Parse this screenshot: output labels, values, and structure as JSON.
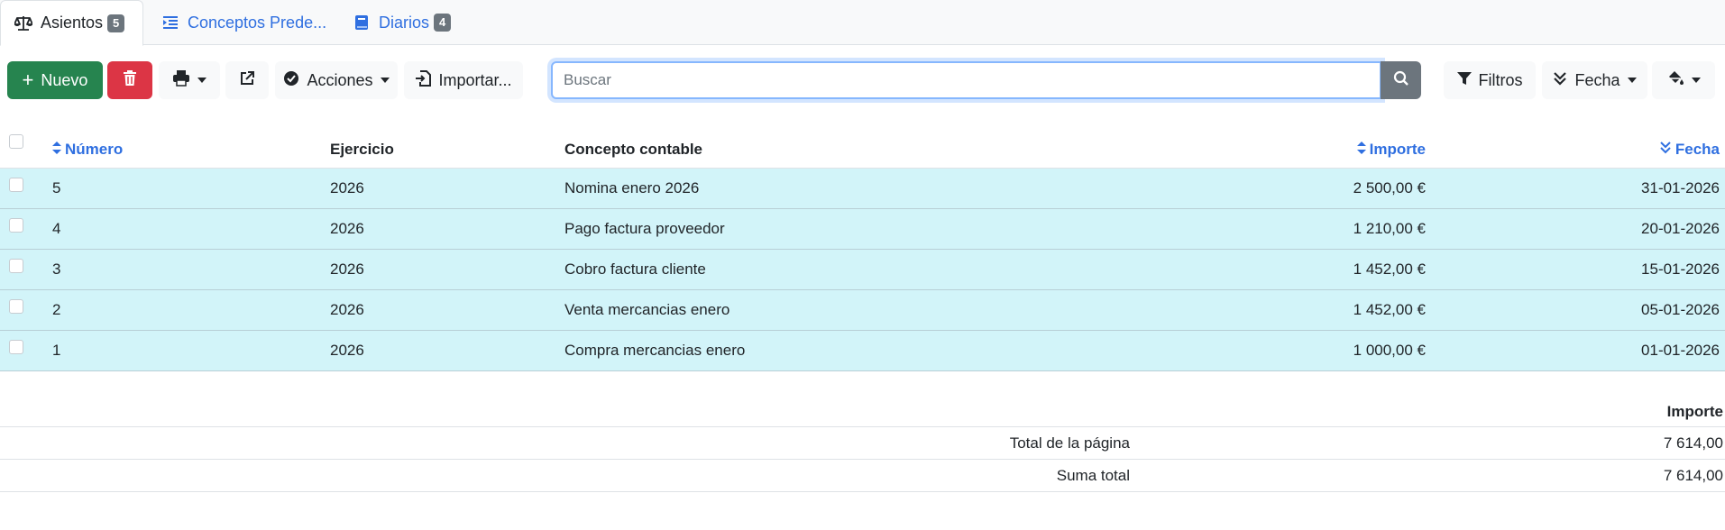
{
  "tabs": [
    {
      "label": "Asientos",
      "badge": "5",
      "icon": "balance-scale-icon"
    },
    {
      "label": "Conceptos Prede...",
      "icon": "list-indent-icon"
    },
    {
      "label": "Diarios",
      "badge": "4",
      "icon": "book-icon"
    }
  ],
  "toolbar": {
    "new_label": "Nuevo",
    "actions_label": "Acciones",
    "import_label": "Importar...",
    "filters_label": "Filtros",
    "date_label": "Fecha"
  },
  "search": {
    "placeholder": "Buscar",
    "value": ""
  },
  "table": {
    "columns": [
      "Número",
      "Ejercicio",
      "Concepto contable",
      "Importe",
      "Fecha"
    ],
    "rows": [
      {
        "numero": "5",
        "ejercicio": "2026",
        "concepto": "Nomina enero 2026",
        "importe": "2 500,00 €",
        "fecha": "31-01-2026"
      },
      {
        "numero": "4",
        "ejercicio": "2026",
        "concepto": "Pago factura proveedor",
        "importe": "1 210,00 €",
        "fecha": "20-01-2026"
      },
      {
        "numero": "3",
        "ejercicio": "2026",
        "concepto": "Cobro factura cliente",
        "importe": "1 452,00 €",
        "fecha": "15-01-2026"
      },
      {
        "numero": "2",
        "ejercicio": "2026",
        "concepto": "Venta mercancias enero",
        "importe": "1 452,00 €",
        "fecha": "05-01-2026"
      },
      {
        "numero": "1",
        "ejercicio": "2026",
        "concepto": "Compra mercancias enero",
        "importe": "1 000,00 €",
        "fecha": "01-01-2026"
      }
    ]
  },
  "totals": {
    "header": "Importe",
    "page_label": "Total de la página",
    "page_value": "7 614,00",
    "sum_label": "Suma total",
    "sum_value": "7 614,00"
  },
  "colors": {
    "accent": "#2f6fe0",
    "success": "#26844f",
    "danger": "#dc3545",
    "row_highlight": "#d2f4f9"
  }
}
